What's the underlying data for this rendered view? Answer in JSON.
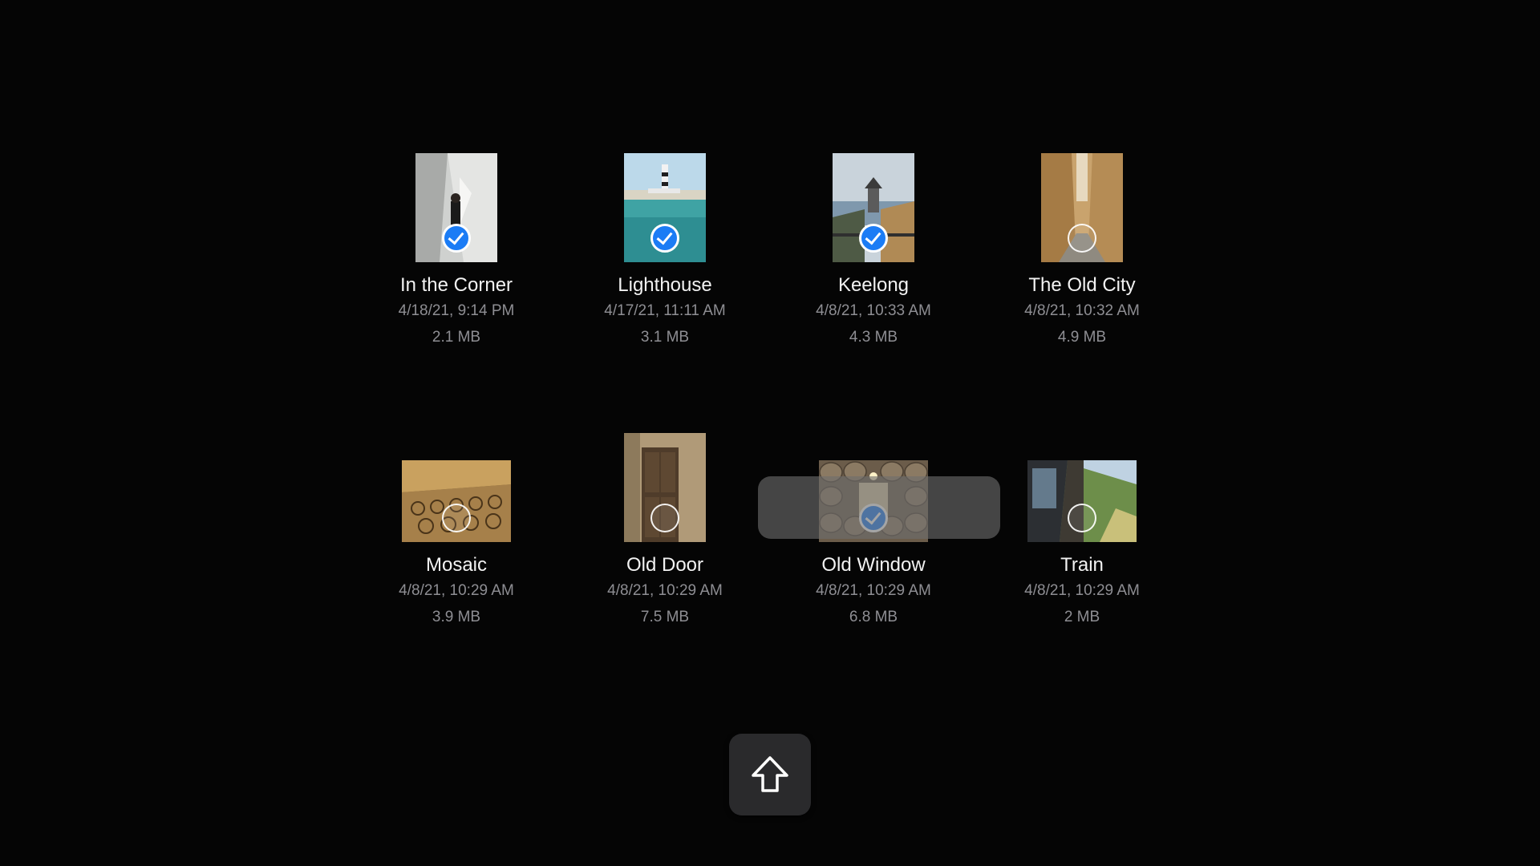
{
  "files": [
    {
      "name": "In the Corner",
      "date": "4/18/21, 9:14 PM",
      "size": "2.1 MB",
      "selected": true,
      "orientation": "portrait"
    },
    {
      "name": "Lighthouse",
      "date": "4/17/21, 11:11 AM",
      "size": "3.1 MB",
      "selected": true,
      "orientation": "portrait"
    },
    {
      "name": "Keelong",
      "date": "4/8/21, 10:33 AM",
      "size": "4.3 MB",
      "selected": true,
      "orientation": "portrait"
    },
    {
      "name": "The Old City",
      "date": "4/8/21, 10:32 AM",
      "size": "4.9 MB",
      "selected": false,
      "orientation": "portrait"
    },
    {
      "name": "Mosaic",
      "date": "4/8/21, 10:29 AM",
      "size": "3.9 MB",
      "selected": false,
      "orientation": "landscape"
    },
    {
      "name": "Old Door",
      "date": "4/8/21, 10:29 AM",
      "size": "7.5 MB",
      "selected": false,
      "orientation": "portrait"
    },
    {
      "name": "Old Window",
      "date": "4/8/21, 10:29 AM",
      "size": "6.8 MB",
      "selected": true,
      "orientation": "landscape"
    },
    {
      "name": "Train",
      "date": "4/8/21, 10:29 AM",
      "size": "2 MB",
      "selected": false,
      "orientation": "landscape"
    }
  ],
  "share_button": {
    "icon": "share-up-arrow-icon"
  },
  "colors": {
    "background": "#050505",
    "selection_blue": "#1b7cf5",
    "meta_text": "#8e8e93"
  }
}
